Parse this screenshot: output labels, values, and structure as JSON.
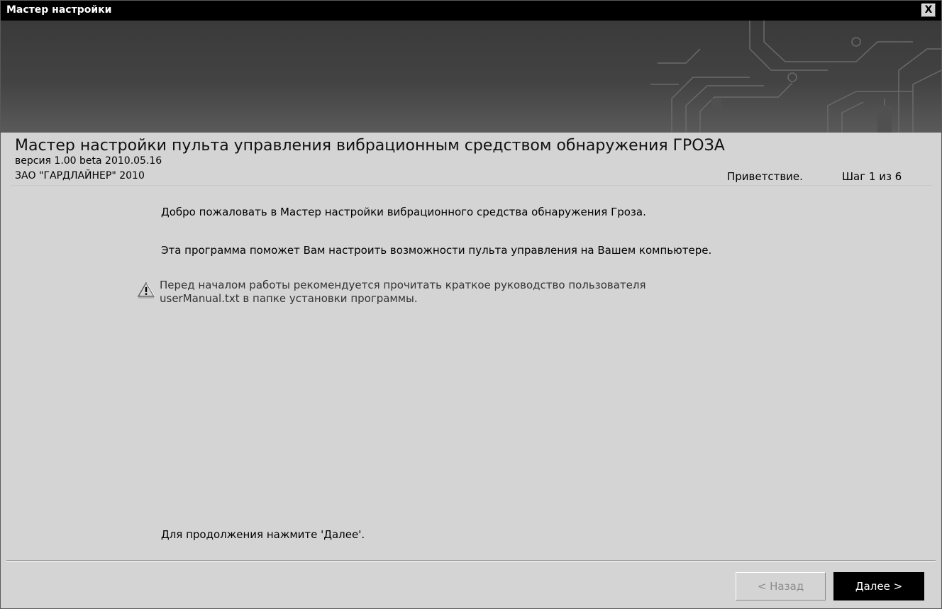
{
  "window": {
    "title": "Мастер настройки",
    "close_label": "X"
  },
  "header": {
    "heading": "Мастер настройки пульта управления вибрационным средством обнаружения ГРОЗА",
    "version": "версия  1.00 beta 2010.05.16",
    "company": "ЗАО \"ГАРДЛАЙНЕР\" 2010",
    "step_label": "Приветствие.",
    "step_count": "Шаг 1 из 6"
  },
  "body": {
    "welcome": "Добро пожаловать в Мастер настройки вибрационного средства обнаружения Гроза.",
    "description": "Эта программа поможет Вам настроить возможности пульта управления на Вашем компьютере.",
    "warning_line1": "Перед началом работы рекомендуется прочитать краткое руководство пользователя",
    "warning_line2": "userManual.txt в папке установки программы.",
    "warning_icon": "warning-icon",
    "continue_hint": "Для продолжения нажмите 'Далее'."
  },
  "footer": {
    "back_label": "< Назад",
    "back_enabled": false,
    "next_label": "Далее >"
  },
  "colors": {
    "titlebar": "#000000",
    "banner": "#404040",
    "dialog_bg": "#d4d4d4",
    "next_button_bg": "#000000"
  }
}
